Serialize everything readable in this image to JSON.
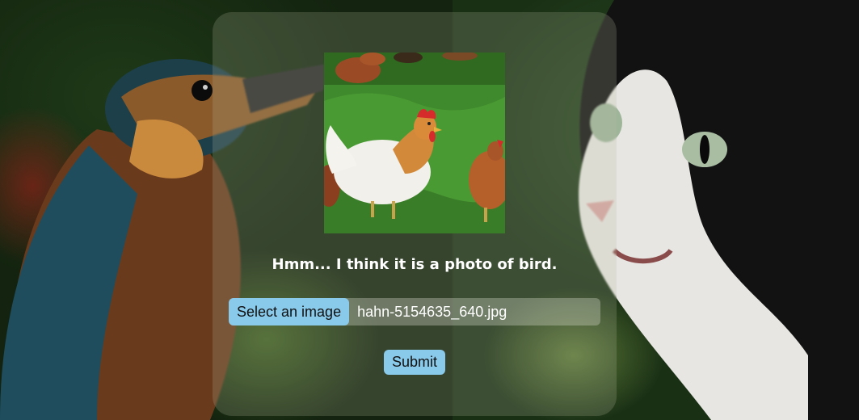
{
  "prediction": {
    "text": "Hmm... I think it is a photo of bird."
  },
  "upload": {
    "select_label": "Select an image",
    "file_name": "hahn-5154635_640.jpg"
  },
  "actions": {
    "submit_label": "Submit"
  },
  "colors": {
    "button_bg": "#89c9ea",
    "text": "#ffffff"
  }
}
